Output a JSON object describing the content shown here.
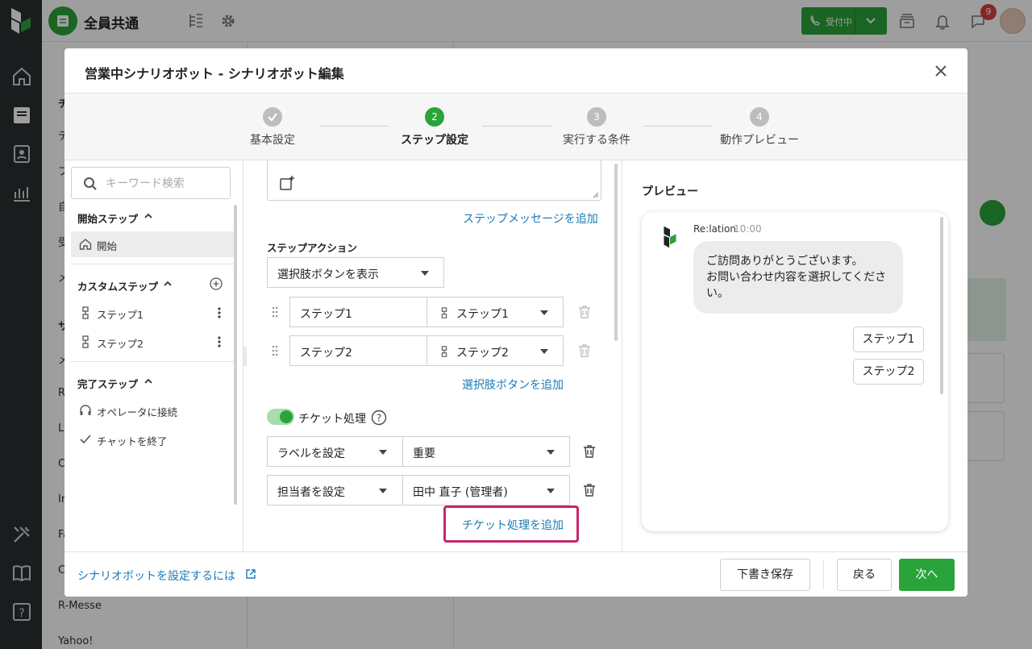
{
  "app": {
    "workspace_name": "全員共通",
    "status_label": "受付中",
    "notification_count": "9",
    "list_fragments": [
      "チ",
      "テ",
      "フ",
      "自",
      "受",
      "メ",
      "サ",
      "メ",
      "R",
      "L",
      "C",
      "In",
      "Fa",
      "C",
      "R-Messe",
      "Yahoo!"
    ]
  },
  "modal": {
    "title": "営業中シナリオボット - シナリオボット編集",
    "steps": [
      {
        "number": "✓",
        "label": "基本設定",
        "state": "done"
      },
      {
        "number": "2",
        "label": "ステップ設定",
        "state": "active"
      },
      {
        "number": "3",
        "label": "実行する条件",
        "state": "todo"
      },
      {
        "number": "4",
        "label": "動作プレビュー",
        "state": "todo"
      }
    ],
    "search": {
      "placeholder": "キーワード検索",
      "value": ""
    },
    "tree": {
      "start_section": "開始ステップ",
      "start_item": "開始",
      "custom_section": "カスタムステップ",
      "custom_items": [
        "ステップ1",
        "ステップ2"
      ],
      "complete_section": "完了ステップ",
      "complete_items": [
        "オペレータに接続",
        "チャットを終了"
      ]
    },
    "editor": {
      "add_step_message": "ステップメッセージを追加",
      "step_action_label": "ステップアクション",
      "step_action_value": "選択肢ボタンを表示",
      "choices": [
        {
          "text": "ステップ1",
          "target": "ステップ1"
        },
        {
          "text": "ステップ2",
          "target": "ステップ2"
        }
      ],
      "add_choice": "選択肢ボタンを追加",
      "ticket_toggle_label": "チケット処理",
      "ticket_toggle_on": true,
      "ticket_rows": [
        {
          "action": "ラベルを設定",
          "value": "重要"
        },
        {
          "action": "担当者を設定",
          "value": "田中 直子 (管理者)"
        }
      ],
      "add_ticket": "チケット処理を追加"
    },
    "preview": {
      "title": "プレビュー",
      "bot_name": "Re:lation",
      "time": "10:00",
      "message_line1": "ご訪問ありがとうございます。",
      "message_line2": "お問い合わせ内容を選択してくださ",
      "message_line3": "い。",
      "choices": [
        "ステップ1",
        "ステップ2"
      ]
    },
    "footer": {
      "help_link": "シナリオボットを設定するには",
      "save_draft": "下書き保存",
      "back": "戻る",
      "next": "次へ"
    }
  },
  "colors": {
    "accent_green": "#2aa33a",
    "link_blue": "#1a7ab8",
    "highlight_magenta": "#c6266d"
  }
}
